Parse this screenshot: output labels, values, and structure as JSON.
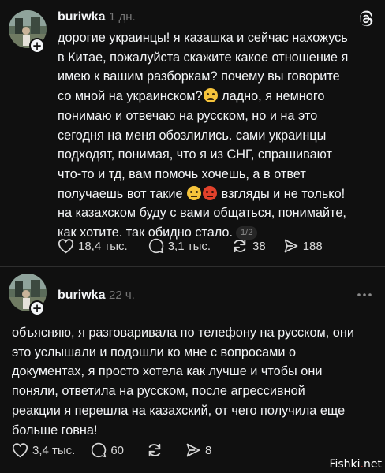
{
  "post1": {
    "username": "buriwka",
    "time": "1 дн.",
    "text_part1": "дорогие украинцы! я казашка и сейчас нахожусь\nв Китае, пожалуйста скажите какое отношение я\nимею к вашим разборкам? почему вы говорите\nсо мной на украинском?",
    "text_part2": " ладно, я немного\nпонимаю и отвечаю на русском, но и на это\nсегодня на меня обозлились. сами украинцы\nподходят, понимая, что я из СНГ, спрашивают\nчто-то и тд, вам помочь хочешь, а в ответ\nполучаешь вот такие ",
    "text_part3": " взгляды и не только!\nна казахском буду с вами общаться, понимайте,\nкак хотите. так обидно стало.",
    "page_badge": "1/2",
    "likes": "18,4 тыс.",
    "comments": "3,1 тыс.",
    "reposts": "38",
    "shares": "188"
  },
  "post2": {
    "username": "buriwka",
    "time": "22 ч.",
    "text": "объясняю, я разговаривала по телефону на русском, они\nэто услышали и подошли ко мне с вопросами о\nдокументах, я просто хотела как лучше и чтобы они\nпоняли, ответила на русском, после агрессивной\nреакции я перешла на казахский, от чего получила еще\nбольше говна!",
    "likes": "3,4 тыс.",
    "comments": "60",
    "shares": "8"
  },
  "watermark": {
    "brand": "Fishki",
    "dot": ".",
    "tld": "net"
  },
  "icons": {
    "like": "heart-icon",
    "comment": "comment-bubble-icon",
    "repost": "repost-arrows-icon",
    "share": "send-paper-plane-icon",
    "app": "threads-logo-icon",
    "more": "more-dots-icon"
  }
}
